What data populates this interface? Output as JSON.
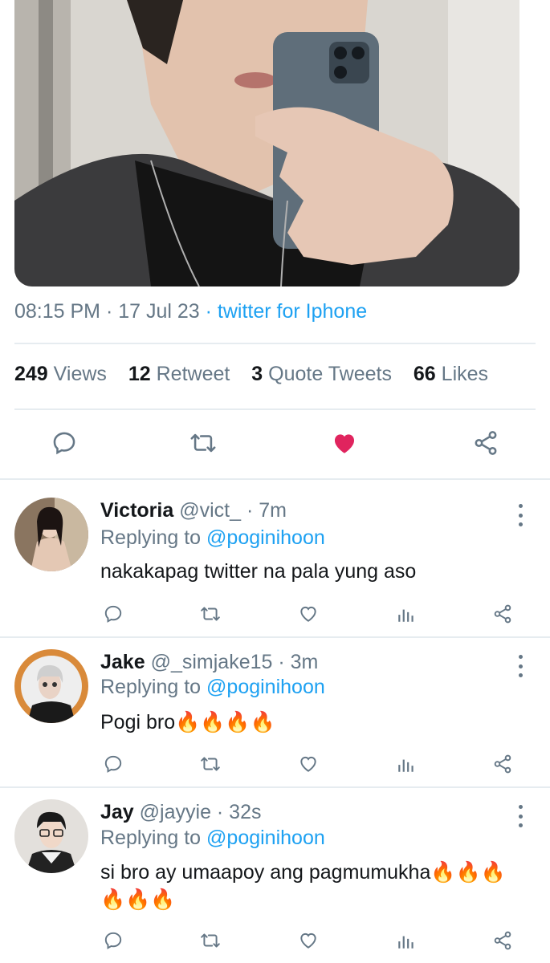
{
  "tweet": {
    "time": "08:15 PM",
    "sep": " · ",
    "date": "17 Jul 23",
    "source": " · twitter for Iphone",
    "stats": [
      {
        "num": "249",
        "label": " Views"
      },
      {
        "num": "12",
        "label": " Retweet"
      },
      {
        "num": "3",
        "label": " Quote Tweets"
      },
      {
        "num": "66",
        "label": " Likes"
      }
    ],
    "actions": [
      "reply-icon",
      "retweet-icon",
      "heart-filled-icon",
      "share-icon"
    ],
    "liked_color": "#e0245e"
  },
  "replies": [
    {
      "name": "Victoria",
      "handle": "@vict_",
      "time": " · 7m",
      "replying_label": "Replying to ",
      "replying_to": "@poginihoon",
      "text": "nakakapag twitter na pala yung aso"
    },
    {
      "name": "Jake",
      "handle": "@_simjake15",
      "time": " · 3m",
      "replying_label": "Replying to ",
      "replying_to": "@poginihoon",
      "text": "Pogi bro🔥🔥🔥🔥"
    },
    {
      "name": "Jay",
      "handle": "@jayyie",
      "time": " · 32s",
      "replying_label": "Replying to ",
      "replying_to": "@poginihoon",
      "text": "si bro ay umaapoy ang pagmumukha🔥🔥🔥🔥🔥🔥"
    }
  ],
  "reply_actions": [
    "reply-icon",
    "retweet-icon",
    "like-icon",
    "analytics-icon",
    "share-icon"
  ],
  "colors": {
    "accent": "#1da1f2",
    "muted": "#657786",
    "divider": "#e6ecf0"
  }
}
